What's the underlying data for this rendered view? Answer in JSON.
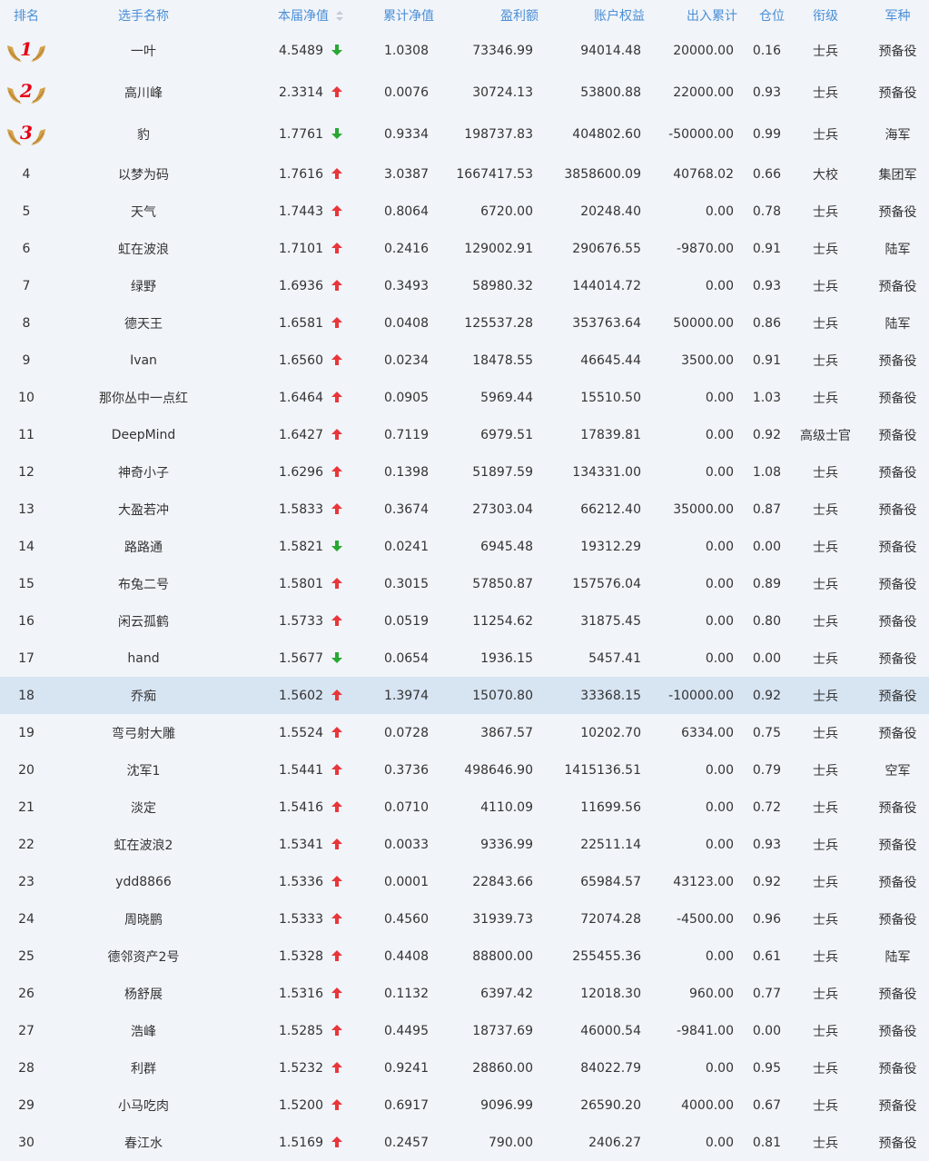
{
  "columns": {
    "rank": "排名",
    "name": "选手名称",
    "nav": "本届净值",
    "cum_nav": "累计净值",
    "profit": "盈利额",
    "equity": "账户权益",
    "flow": "出入累计",
    "position": "仓位",
    "title": "衔级",
    "branch": "军种"
  },
  "colors": {
    "header_text": "#4a8fd6",
    "up": "#e8363a",
    "down": "#27a832",
    "medal_number": "#e60012",
    "highlight_row": "#d7e4f2",
    "medal_wing": "#d4a24a"
  },
  "highlight_row_index": 17,
  "rows": [
    {
      "rank": "1",
      "name": "一叶",
      "nav": "4.5489",
      "trend": "down",
      "cum_nav": "1.0308",
      "profit": "73346.99",
      "equity": "94014.48",
      "flow": "20000.00",
      "position": "0.16",
      "title": "士兵",
      "branch": "预备役"
    },
    {
      "rank": "2",
      "name": "高川峰",
      "nav": "2.3314",
      "trend": "up",
      "cum_nav": "0.0076",
      "profit": "30724.13",
      "equity": "53800.88",
      "flow": "22000.00",
      "position": "0.93",
      "title": "士兵",
      "branch": "预备役"
    },
    {
      "rank": "3",
      "name": "豹",
      "nav": "1.7761",
      "trend": "down",
      "cum_nav": "0.9334",
      "profit": "198737.83",
      "equity": "404802.60",
      "flow": "-50000.00",
      "position": "0.99",
      "title": "士兵",
      "branch": "海军"
    },
    {
      "rank": "4",
      "name": "以梦为码",
      "nav": "1.7616",
      "trend": "up",
      "cum_nav": "3.0387",
      "profit": "1667417.53",
      "equity": "3858600.09",
      "flow": "40768.02",
      "position": "0.66",
      "title": "大校",
      "branch": "集团军"
    },
    {
      "rank": "5",
      "name": "天气",
      "nav": "1.7443",
      "trend": "up",
      "cum_nav": "0.8064",
      "profit": "6720.00",
      "equity": "20248.40",
      "flow": "0.00",
      "position": "0.78",
      "title": "士兵",
      "branch": "预备役"
    },
    {
      "rank": "6",
      "name": "虹在波浪",
      "nav": "1.7101",
      "trend": "up",
      "cum_nav": "0.2416",
      "profit": "129002.91",
      "equity": "290676.55",
      "flow": "-9870.00",
      "position": "0.91",
      "title": "士兵",
      "branch": "陆军"
    },
    {
      "rank": "7",
      "name": "绿野",
      "nav": "1.6936",
      "trend": "up",
      "cum_nav": "0.3493",
      "profit": "58980.32",
      "equity": "144014.72",
      "flow": "0.00",
      "position": "0.93",
      "title": "士兵",
      "branch": "预备役"
    },
    {
      "rank": "8",
      "name": "德天王",
      "nav": "1.6581",
      "trend": "up",
      "cum_nav": "0.0408",
      "profit": "125537.28",
      "equity": "353763.64",
      "flow": "50000.00",
      "position": "0.86",
      "title": "士兵",
      "branch": "陆军"
    },
    {
      "rank": "9",
      "name": "Ivan",
      "nav": "1.6560",
      "trend": "up",
      "cum_nav": "0.0234",
      "profit": "18478.55",
      "equity": "46645.44",
      "flow": "3500.00",
      "position": "0.91",
      "title": "士兵",
      "branch": "预备役"
    },
    {
      "rank": "10",
      "name": "那你丛中一点红",
      "nav": "1.6464",
      "trend": "up",
      "cum_nav": "0.0905",
      "profit": "5969.44",
      "equity": "15510.50",
      "flow": "0.00",
      "position": "1.03",
      "title": "士兵",
      "branch": "预备役"
    },
    {
      "rank": "11",
      "name": "DeepMind",
      "nav": "1.6427",
      "trend": "up",
      "cum_nav": "0.7119",
      "profit": "6979.51",
      "equity": "17839.81",
      "flow": "0.00",
      "position": "0.92",
      "title": "高级士官",
      "branch": "预备役"
    },
    {
      "rank": "12",
      "name": "神奇小子",
      "nav": "1.6296",
      "trend": "up",
      "cum_nav": "0.1398",
      "profit": "51897.59",
      "equity": "134331.00",
      "flow": "0.00",
      "position": "1.08",
      "title": "士兵",
      "branch": "预备役"
    },
    {
      "rank": "13",
      "name": "大盈若冲",
      "nav": "1.5833",
      "trend": "up",
      "cum_nav": "0.3674",
      "profit": "27303.04",
      "equity": "66212.40",
      "flow": "35000.00",
      "position": "0.87",
      "title": "士兵",
      "branch": "预备役"
    },
    {
      "rank": "14",
      "name": "路路通",
      "nav": "1.5821",
      "trend": "down",
      "cum_nav": "0.0241",
      "profit": "6945.48",
      "equity": "19312.29",
      "flow": "0.00",
      "position": "0.00",
      "title": "士兵",
      "branch": "预备役"
    },
    {
      "rank": "15",
      "name": "布兔二号",
      "nav": "1.5801",
      "trend": "up",
      "cum_nav": "0.3015",
      "profit": "57850.87",
      "equity": "157576.04",
      "flow": "0.00",
      "position": "0.89",
      "title": "士兵",
      "branch": "预备役"
    },
    {
      "rank": "16",
      "name": "闲云孤鹤",
      "nav": "1.5733",
      "trend": "up",
      "cum_nav": "0.0519",
      "profit": "11254.62",
      "equity": "31875.45",
      "flow": "0.00",
      "position": "0.80",
      "title": "士兵",
      "branch": "预备役"
    },
    {
      "rank": "17",
      "name": "hand",
      "nav": "1.5677",
      "trend": "down",
      "cum_nav": "0.0654",
      "profit": "1936.15",
      "equity": "5457.41",
      "flow": "0.00",
      "position": "0.00",
      "title": "士兵",
      "branch": "预备役"
    },
    {
      "rank": "18",
      "name": "乔痴",
      "nav": "1.5602",
      "trend": "up",
      "cum_nav": "1.3974",
      "profit": "15070.80",
      "equity": "33368.15",
      "flow": "-10000.00",
      "position": "0.92",
      "title": "士兵",
      "branch": "预备役"
    },
    {
      "rank": "19",
      "name": "弯弓射大雕",
      "nav": "1.5524",
      "trend": "up",
      "cum_nav": "0.0728",
      "profit": "3867.57",
      "equity": "10202.70",
      "flow": "6334.00",
      "position": "0.75",
      "title": "士兵",
      "branch": "预备役"
    },
    {
      "rank": "20",
      "name": "沈军1",
      "nav": "1.5441",
      "trend": "up",
      "cum_nav": "0.3736",
      "profit": "498646.90",
      "equity": "1415136.51",
      "flow": "0.00",
      "position": "0.79",
      "title": "士兵",
      "branch": "空军"
    },
    {
      "rank": "21",
      "name": "淡定",
      "nav": "1.5416",
      "trend": "up",
      "cum_nav": "0.0710",
      "profit": "4110.09",
      "equity": "11699.56",
      "flow": "0.00",
      "position": "0.72",
      "title": "士兵",
      "branch": "预备役"
    },
    {
      "rank": "22",
      "name": "虹在波浪2",
      "nav": "1.5341",
      "trend": "up",
      "cum_nav": "0.0033",
      "profit": "9336.99",
      "equity": "22511.14",
      "flow": "0.00",
      "position": "0.93",
      "title": "士兵",
      "branch": "预备役"
    },
    {
      "rank": "23",
      "name": "ydd8866",
      "nav": "1.5336",
      "trend": "up",
      "cum_nav": "0.0001",
      "profit": "22843.66",
      "equity": "65984.57",
      "flow": "43123.00",
      "position": "0.92",
      "title": "士兵",
      "branch": "预备役"
    },
    {
      "rank": "24",
      "name": "周晓鹏",
      "nav": "1.5333",
      "trend": "up",
      "cum_nav": "0.4560",
      "profit": "31939.73",
      "equity": "72074.28",
      "flow": "-4500.00",
      "position": "0.96",
      "title": "士兵",
      "branch": "预备役"
    },
    {
      "rank": "25",
      "name": "德邻资产2号",
      "nav": "1.5328",
      "trend": "up",
      "cum_nav": "0.4408",
      "profit": "88800.00",
      "equity": "255455.36",
      "flow": "0.00",
      "position": "0.61",
      "title": "士兵",
      "branch": "陆军"
    },
    {
      "rank": "26",
      "name": "杨舒展",
      "nav": "1.5316",
      "trend": "up",
      "cum_nav": "0.1132",
      "profit": "6397.42",
      "equity": "12018.30",
      "flow": "960.00",
      "position": "0.77",
      "title": "士兵",
      "branch": "预备役"
    },
    {
      "rank": "27",
      "name": "浩峰",
      "nav": "1.5285",
      "trend": "up",
      "cum_nav": "0.4495",
      "profit": "18737.69",
      "equity": "46000.54",
      "flow": "-9841.00",
      "position": "0.00",
      "title": "士兵",
      "branch": "预备役"
    },
    {
      "rank": "28",
      "name": "利群",
      "nav": "1.5232",
      "trend": "up",
      "cum_nav": "0.9241",
      "profit": "28860.00",
      "equity": "84022.79",
      "flow": "0.00",
      "position": "0.95",
      "title": "士兵",
      "branch": "预备役"
    },
    {
      "rank": "29",
      "name": "小马吃肉",
      "nav": "1.5200",
      "trend": "up",
      "cum_nav": "0.6917",
      "profit": "9096.99",
      "equity": "26590.20",
      "flow": "4000.00",
      "position": "0.67",
      "title": "士兵",
      "branch": "预备役"
    },
    {
      "rank": "30",
      "name": "春江水",
      "nav": "1.5169",
      "trend": "up",
      "cum_nav": "0.2457",
      "profit": "790.00",
      "equity": "2406.27",
      "flow": "0.00",
      "position": "0.81",
      "title": "士兵",
      "branch": "预备役"
    }
  ]
}
